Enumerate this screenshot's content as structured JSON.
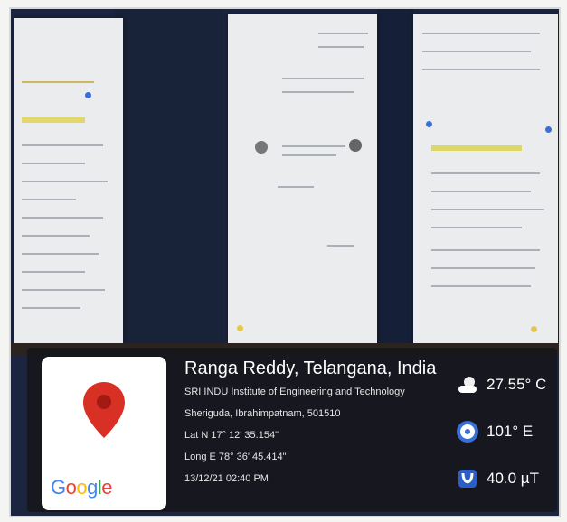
{
  "overlay": {
    "location_title": "Ranga Reddy, Telangana, India",
    "lines": [
      "SRI INDU Institute of Engineering and Technology",
      "Sheriguda, Ibrahimpatnam, 501510",
      "Lat N 17° 12' 35.154\"",
      "Long E 78° 36' 45.414\"",
      "13/12/21 02:40 PM"
    ],
    "logo_text": "Google",
    "stats": {
      "temperature": "27.55° C",
      "direction": "101° E",
      "magnetic": "40.0 µT"
    }
  },
  "icons": {
    "map_pin": "map-pin-icon",
    "weather": "cloud-sun-icon",
    "compass": "compass-icon",
    "magnet": "magnetic-field-icon"
  },
  "colors": {
    "pin_red": "#d93025",
    "overlay_bg": "#16161a",
    "google_blue": "#4285f4",
    "google_red": "#ea4335",
    "google_yellow": "#fbbc05",
    "google_green": "#34a853"
  }
}
